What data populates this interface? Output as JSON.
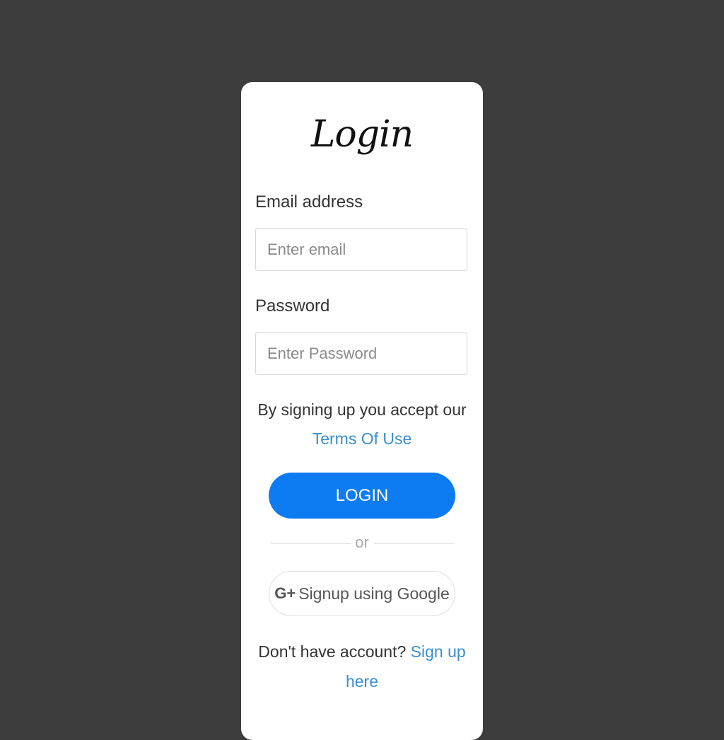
{
  "login_form": {
    "title": "Login",
    "email": {
      "label": "Email address",
      "placeholder": "Enter email",
      "value": ""
    },
    "password": {
      "label": "Password",
      "placeholder": "Enter Password",
      "value": ""
    },
    "terms_text": "By signing up you accept our",
    "terms_link": "Terms Of Use",
    "login_button": "LOGIN",
    "divider_text": "or",
    "google_icon_text": "G+",
    "google_button": "Signup using Google",
    "signup_prompt": "Don't have account?",
    "signup_link": "Sign up here"
  },
  "colors": {
    "background": "#3d3d3d",
    "card": "#ffffff",
    "primary_button": "#0d7cf3",
    "link": "#3a8fd0"
  },
  "icons": {
    "google": "google-plus-icon"
  }
}
